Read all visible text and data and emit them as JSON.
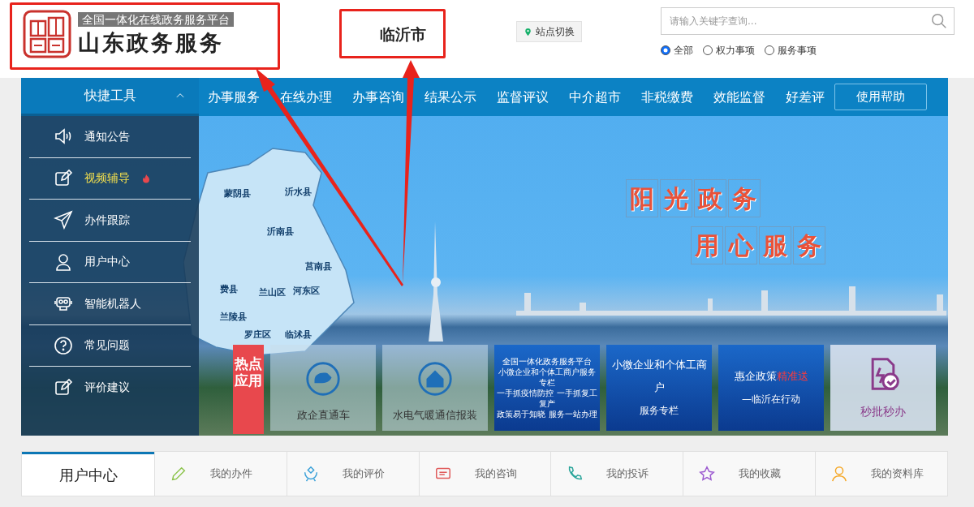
{
  "header": {
    "logo": {
      "tagline": "全国一体化在线政务服务平台",
      "title": "山东政务服务"
    },
    "city": "临沂市",
    "site_switch": "站点切换",
    "search": {
      "placeholder": "请输入关键字查询..."
    },
    "scopes": [
      {
        "label": "全部",
        "selected": true
      },
      {
        "label": "权力事项",
        "selected": false
      },
      {
        "label": "服务事项",
        "selected": false
      }
    ]
  },
  "nav": {
    "quick_tools": {
      "label": "快捷工具",
      "expanded": true
    },
    "items": [
      "办事服务",
      "在线办理",
      "办事咨询",
      "结果公示",
      "监督评议",
      "中介超市",
      "非税缴费",
      "效能监督",
      "好差评"
    ],
    "help": "使用帮助"
  },
  "sidebar": {
    "items": [
      {
        "label": "通知公告",
        "selected": false,
        "hot": false
      },
      {
        "label": "视频辅导",
        "selected": true,
        "hot": true
      },
      {
        "label": "办件跟踪",
        "selected": false,
        "hot": false
      },
      {
        "label": "用户中心",
        "selected": false,
        "hot": false
      },
      {
        "label": "智能机器人",
        "selected": false,
        "hot": false
      },
      {
        "label": "常见问题",
        "selected": false,
        "hot": false
      },
      {
        "label": "评价建议",
        "selected": false,
        "hot": false
      }
    ]
  },
  "banner": {
    "slogans": [
      "阳光政务",
      "用心服务"
    ],
    "map_labels": [
      "蒙阴县",
      "沂水县",
      "沂南县",
      "费县",
      "兰山区",
      "河东区",
      "莒南县",
      "罗庄区",
      "临沭县",
      "兰陵县"
    ]
  },
  "hot_apps": {
    "title": "热点应用",
    "tiles": [
      {
        "kind": "icon",
        "lines": [
          "政企直通车"
        ]
      },
      {
        "kind": "icon",
        "lines": [
          "水电气暖通信报装"
        ]
      },
      {
        "kind": "poster",
        "lines": [
          "全国一体化政务服务平台",
          "小微企业和个体工商户服务专栏",
          "一手抓疫情防控 一手抓复工复产",
          "政策易于知晓 服务一站办理"
        ]
      },
      {
        "kind": "poster",
        "lines": [
          "小微企业和个体工商户",
          "服务专栏"
        ]
      },
      {
        "kind": "poster",
        "lines": [
          "惠企政策",
          "—临沂在行动"
        ],
        "accent": "精准送"
      },
      {
        "kind": "light",
        "lines": [
          "秒批秒办"
        ]
      }
    ]
  },
  "user_center": {
    "title": "用户中心",
    "items": [
      {
        "label": "我的办件",
        "color": "#8bc34a"
      },
      {
        "label": "我的评价",
        "color": "#3aa0d8"
      },
      {
        "label": "我的咨询",
        "color": "#e05a5a"
      },
      {
        "label": "我的投诉",
        "color": "#2aa59a"
      },
      {
        "label": "我的收藏",
        "color": "#9b59d0"
      },
      {
        "label": "我的资料库",
        "color": "#f5a623"
      }
    ]
  }
}
